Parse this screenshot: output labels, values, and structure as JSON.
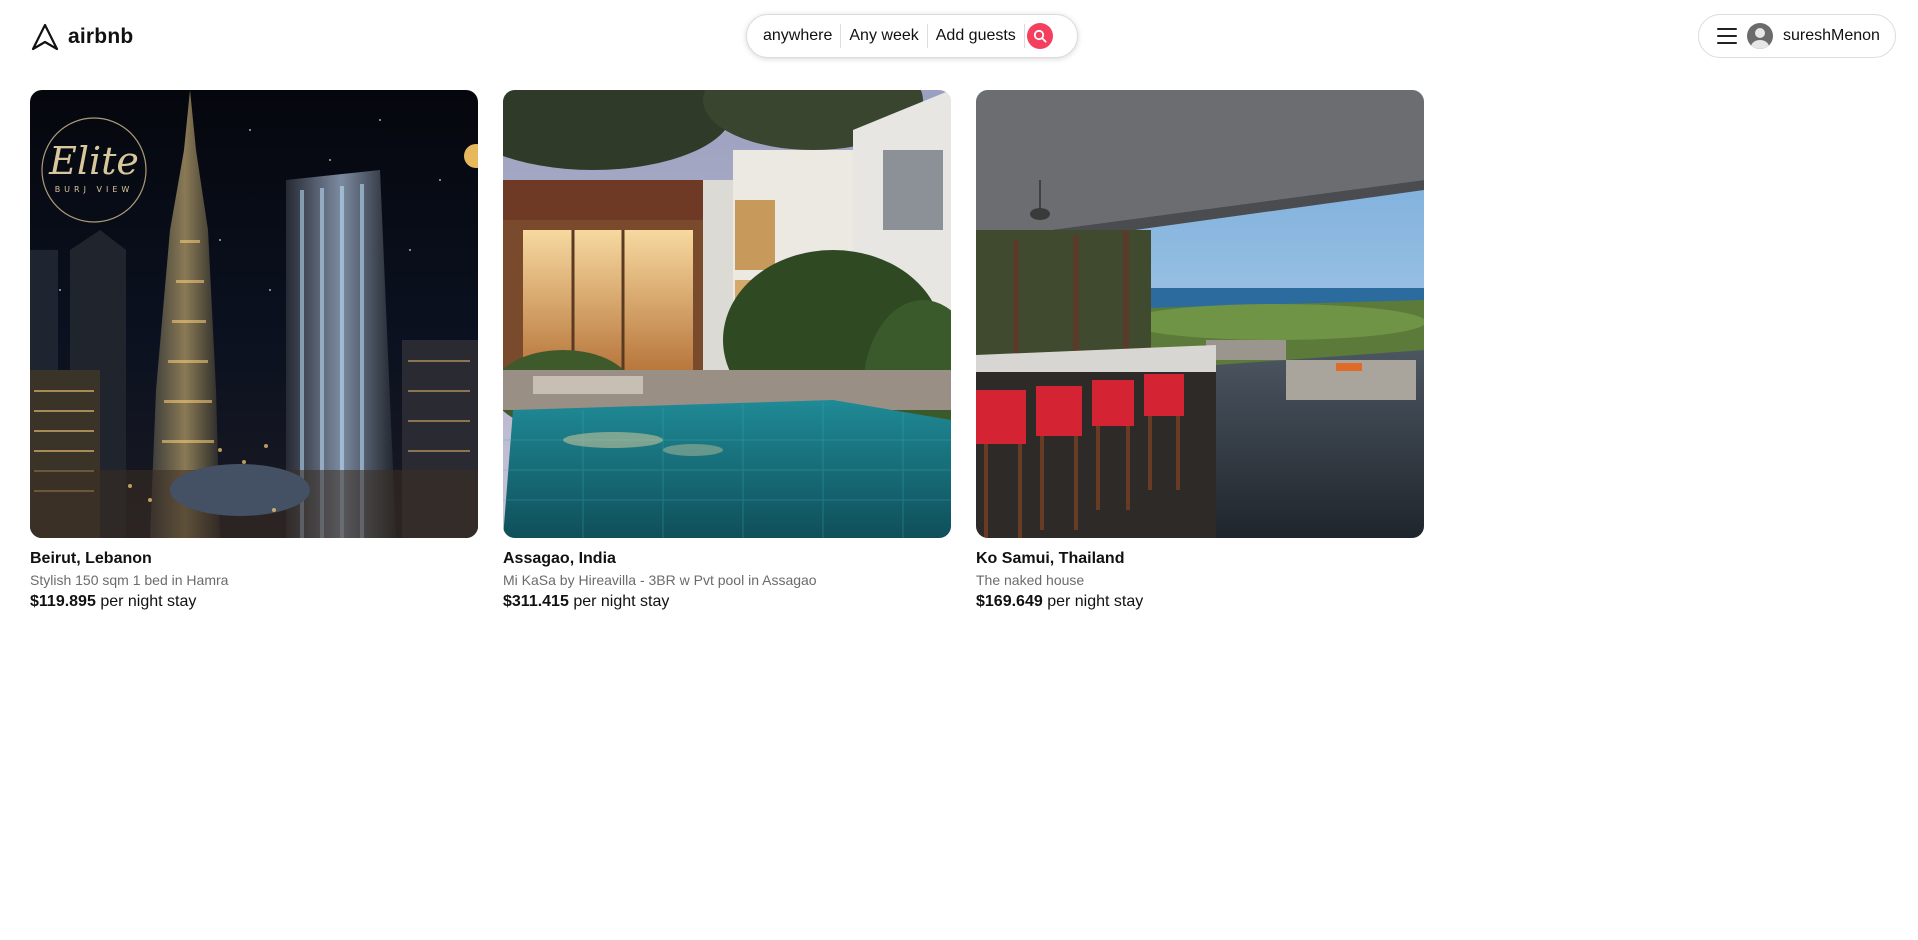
{
  "header": {
    "brand": "airbnb",
    "search": {
      "location": "anywhere",
      "dates": "Any week",
      "guests": "Add guests"
    },
    "user": {
      "name": "sureshMenon"
    }
  },
  "listings": [
    {
      "title": "Beirut, Lebanon",
      "description": "Stylish 150 sqm 1 bed in Hamra",
      "price": "$119.895",
      "price_suffix": "per night stay",
      "badge_script": "Elite",
      "badge_caption": "BURJ VIEW",
      "photo_icon": "night-skyline-photo"
    },
    {
      "title": "Assagao, India",
      "description": "Mi KaSa by Hireavilla - 3BR w Pvt pool in Assagao",
      "price": "$311.415",
      "price_suffix": "per night stay",
      "photo_icon": "villa-pool-photo"
    },
    {
      "title": "Ko Samui, Thailand",
      "description": "The naked house",
      "price": "$169.649",
      "price_suffix": "per night stay",
      "photo_icon": "ocean-view-kitchen-photo"
    }
  ],
  "colors": {
    "accent": "#f43f5e",
    "text_primary": "#111111",
    "text_secondary": "#6b6b6b",
    "border": "#dcdcdc"
  }
}
